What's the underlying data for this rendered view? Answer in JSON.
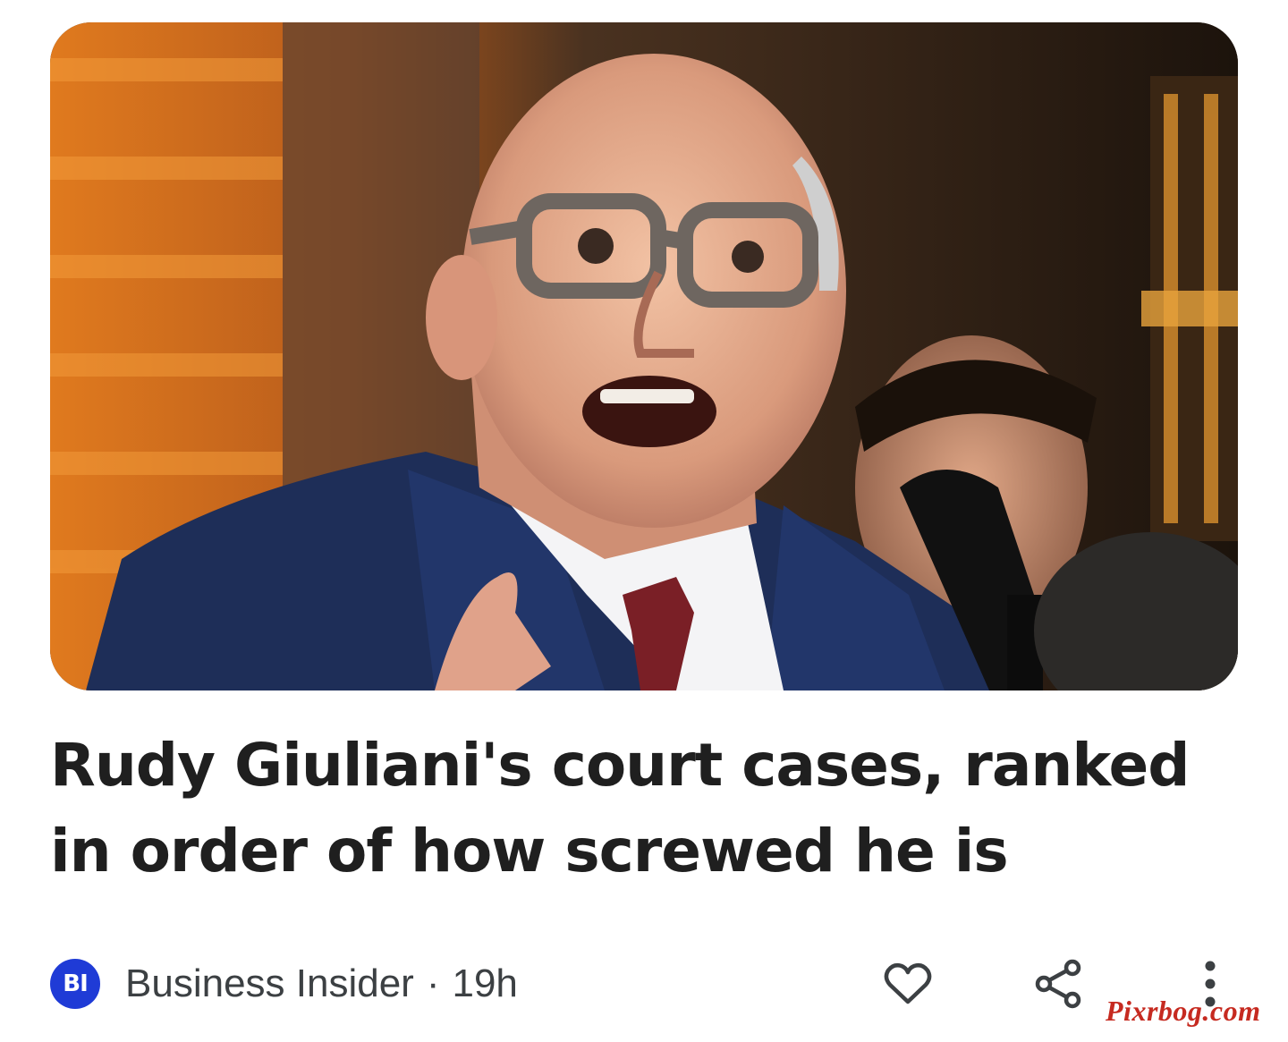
{
  "article": {
    "headline": "Rudy Giuliani's court cases, ranked in order of how screwed he is",
    "source": {
      "logo_text": "BI",
      "name": "Business Insider",
      "separator": "·",
      "age": "19h",
      "logo_color": "#1f3bd6"
    }
  },
  "actions": {
    "like_icon": "heart-outline-icon",
    "share_icon": "share-icon",
    "more_icon": "more-vertical-icon"
  },
  "watermark": {
    "text": "Pixrbog.com",
    "color": "#c62a20"
  }
}
